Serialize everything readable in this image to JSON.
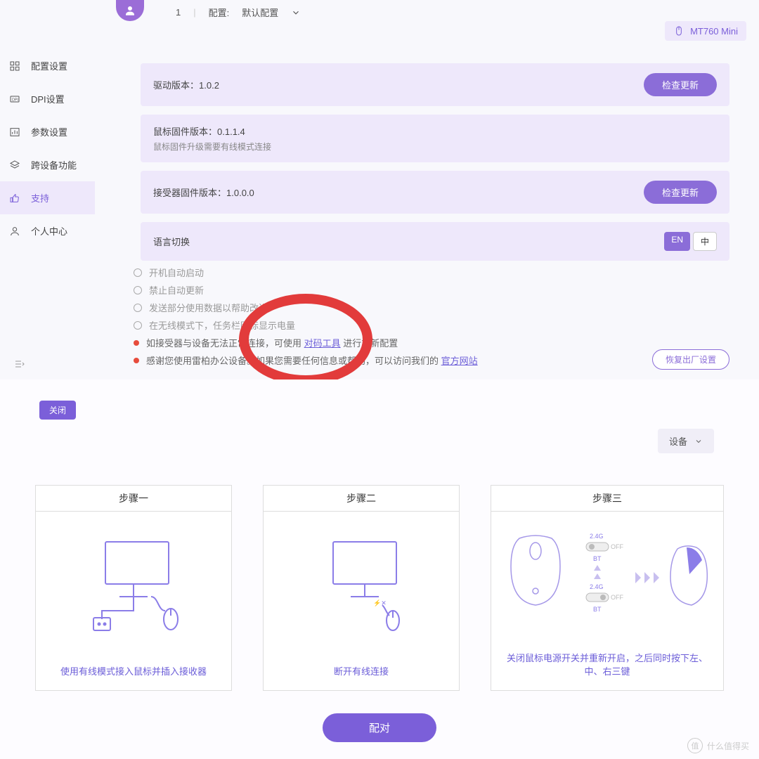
{
  "header": {
    "config_number": "1",
    "config_label": "配置:",
    "config_value": "默认配置",
    "device_name": "MT760 Mini"
  },
  "sidebar": {
    "items": [
      {
        "icon": "grid",
        "label": "配置设置"
      },
      {
        "icon": "dpi",
        "label": "DPI设置"
      },
      {
        "icon": "params",
        "label": "参数设置"
      },
      {
        "icon": "layers",
        "label": "跨设备功能"
      },
      {
        "icon": "thumb",
        "label": "支持"
      },
      {
        "icon": "user",
        "label": "个人中心"
      }
    ]
  },
  "info": {
    "driver_label": "驱动版本：",
    "driver_version": "1.0.2",
    "check_update": "检查更新",
    "fw_label": "鼠标固件版本：",
    "fw_version": "0.1.1.4",
    "fw_note": "鼠标固件升级需要有线模式连接",
    "recv_label": "接受器固件版本：",
    "recv_version": "1.0.0.0",
    "lang_label": "语言切换",
    "lang_en": "EN",
    "lang_cn": "中"
  },
  "options": {
    "o1": "开机自动启动",
    "o2": "禁止自动更新",
    "o3": "发送部分使用数据以帮助改进",
    "o4": "在无线模式下，任务栏图标显示电量",
    "b1_pre": "如接受器与设备无法正常连接，可使用 ",
    "b1_link": "对码工具",
    "b1_post": " 进行重新配置",
    "b2_pre": "感谢您使用雷柏办公设备。如果您需要任何信息或帮助，可以访问我们的 ",
    "b2_link": "官方网站"
  },
  "reset_label": "恢复出厂设置",
  "modal": {
    "close": "关闭",
    "device_dd": "设备",
    "steps": [
      {
        "title": "步骤一",
        "caption": "使用有线模式接入鼠标并插入接收器"
      },
      {
        "title": "步骤二",
        "caption": "断开有线连接"
      },
      {
        "title": "步骤三",
        "caption": "关闭鼠标电源开关并重新开启，之后同时按下左、中、右三键"
      }
    ],
    "step3_labels": {
      "g24": "2.4G",
      "off": "OFF",
      "bt": "BT"
    },
    "pair": "配对"
  },
  "watermark": "什么值得买"
}
